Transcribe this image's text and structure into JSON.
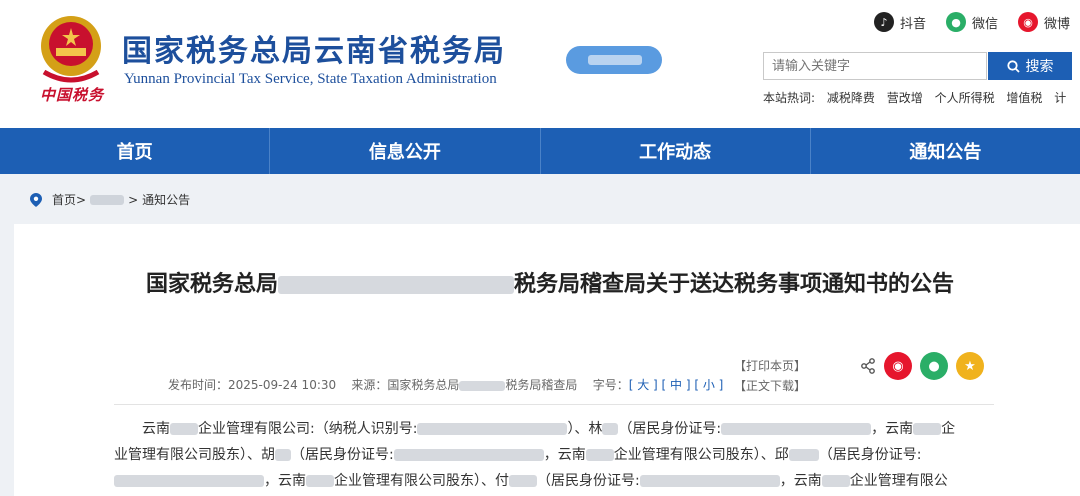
{
  "header": {
    "title_cn": "国家税务总局云南省税务局",
    "title_en": "Yunnan Provincial Tax Service, State Taxation Administration",
    "brand_sub": "中国税务",
    "social": [
      {
        "label": "抖音",
        "icon": "tiktok-icon",
        "color": "#222222"
      },
      {
        "label": "微信",
        "icon": "wechat-icon",
        "color": "#2aae67"
      },
      {
        "label": "微博",
        "icon": "weibo-icon",
        "color": "#e6162d"
      }
    ],
    "search": {
      "placeholder": "请输入关键字",
      "button": "搜索"
    },
    "hot": {
      "label": "本站热词:",
      "items": [
        "减税降费",
        "营改增",
        "个人所得税",
        "增值税",
        "计"
      ]
    }
  },
  "nav": {
    "items": [
      "首页",
      "信息公开",
      "工作动态",
      "通知公告"
    ]
  },
  "breadcrumb": {
    "home": "首页>",
    "sep": ">",
    "current": "通知公告"
  },
  "article": {
    "title_start": "国家税务总局",
    "title_end": "税务局稽查局关于送达税务事项通知书的公告",
    "meta_date": "发布时间：2025-09-24 10:30",
    "meta_source": "来源：国家税务总局",
    "meta_source_end": "税务局稽查局",
    "font_label": "字号：",
    "sizes": "[ 大 ] [ 中 ] [ 小 ]",
    "print": "【打印本页】",
    "download": "【正文下载】",
    "share_icons": [
      "share-icon",
      "weibo-icon",
      "wechat-icon",
      "favorite-icon"
    ],
    "body_lines": [
      {
        "a": "云南",
        "b": "企业管理有限公司:（纳税人识别号:",
        "c": "）、林",
        "d": "（居民身份证号:",
        "e": "，云南",
        "f": "企"
      },
      {
        "a": "业管理有限公司股东）、胡",
        "b": "（居民身份证号:",
        "c": "，云南",
        "d": "企业管理有限公司股东）、邱",
        "e": "（居民身份证号:"
      },
      {
        "a": "，云南",
        "b": "企业管理有限公司股东）、付",
        "c": "（居民身份证号:",
        "d": "，云南",
        "e": "企业管理有限公"
      }
    ]
  },
  "colors": {
    "brand_blue": "#1d5fb4",
    "title_blue": "#1d4f9c",
    "accent_red": "#c8102e"
  }
}
